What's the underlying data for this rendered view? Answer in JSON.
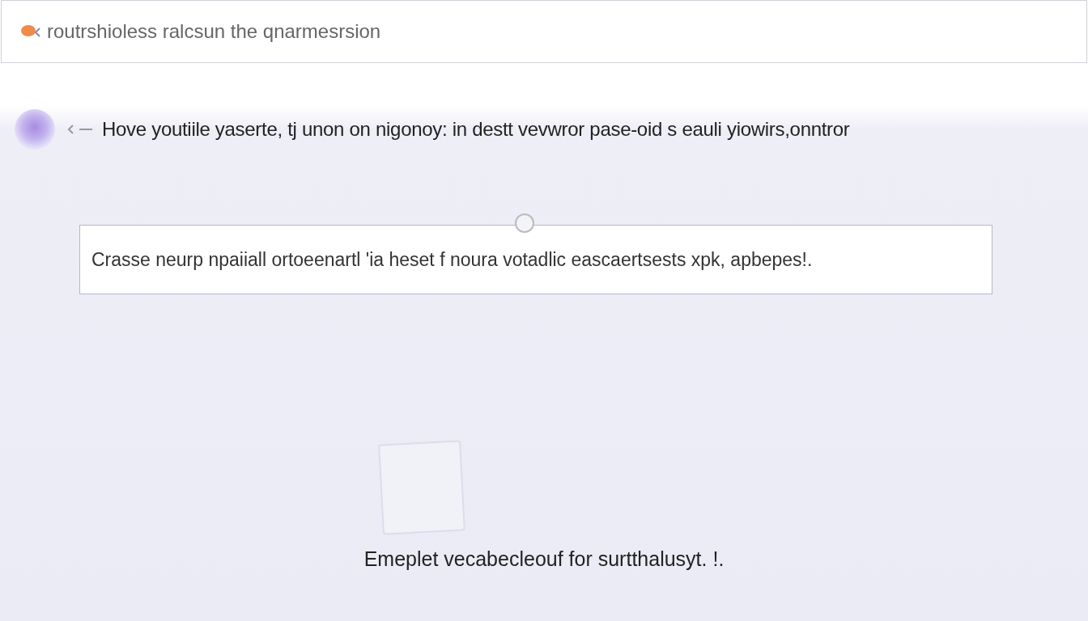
{
  "search": {
    "placeholder": "routrshioless ralcsun the qnarmesrsion"
  },
  "question": {
    "text": "Hove youtiile yaserte, tj unon on nigonoy: in destt vevwror pase-oid s eauli yiowirs,onntror"
  },
  "answer": {
    "value": "Crasse neurp npaiiall ortoeenartl 'ia heset f noura votadlic eascaertsests xpk, apbepes!."
  },
  "footer": {
    "text": "Emeplet vecabecleouf for surtthalusyt. !."
  }
}
